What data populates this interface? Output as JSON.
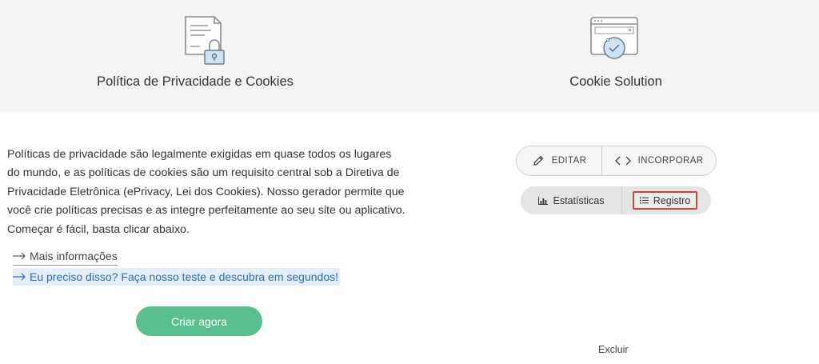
{
  "products": {
    "privacy": {
      "title": "Política de Privacidade e Cookies",
      "icon": "privacy-policy-document-lock-icon"
    },
    "cookie": {
      "title": "Cookie Solution",
      "icon": "cookie-browser-window-icon"
    }
  },
  "description": "Políticas de privacidade são legalmente exigidas em quase todos os lugares do mundo, e as políticas de cookies são um requisito central sob a Diretiva de Privacidade Eletrônica (ePrivacy, Lei dos Cookies). Nosso gerador permite que você crie políticas precisas e as integre perfeitamente ao seu site ou aplicativo. Começar é fácil, basta clicar abaixo.",
  "links": {
    "more_info": "Mais informações",
    "need_test": "Eu preciso disso? Faça nosso teste e descubra em segundos!"
  },
  "create_button": "Criar agora",
  "actions": {
    "edit": "EDITAR",
    "embed": "INCORPORAR",
    "stats": "Estatísticas",
    "registro": "Registro",
    "delete": "Excluir"
  },
  "colors": {
    "accent_green": "#58c08f",
    "link_blue": "#2f6bb0",
    "highlight_red": "#c8473b",
    "band_gray": "#f4f4f4"
  }
}
